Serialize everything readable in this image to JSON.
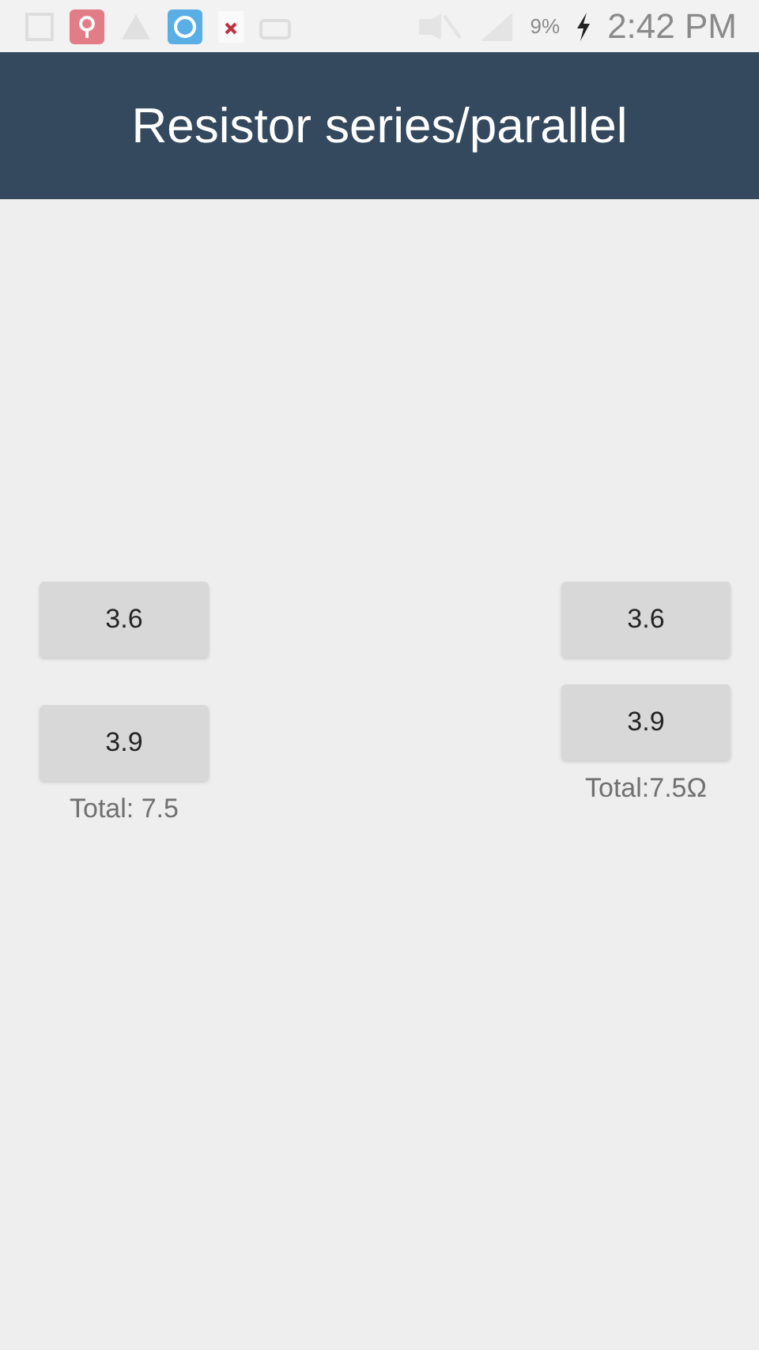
{
  "status_bar": {
    "battery": "9%",
    "time": "2:42 PM"
  },
  "app_bar": {
    "title": "Resistor series/parallel"
  },
  "series": {
    "buttons": [
      "3.6",
      "3.9"
    ],
    "total": "Total: 7.5"
  },
  "parallel": {
    "buttons": [
      "3.6",
      "3.9"
    ],
    "total": "Total:7.5Ω"
  }
}
